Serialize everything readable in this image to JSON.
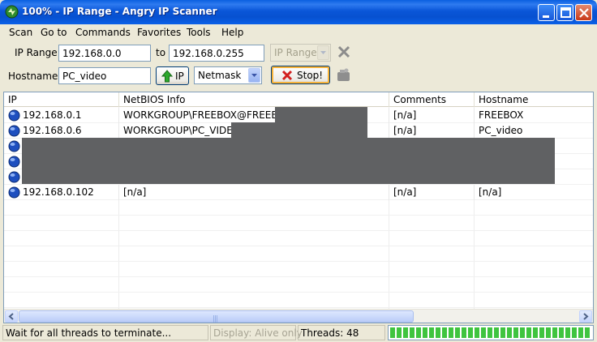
{
  "window": {
    "title": "100% - IP Range - Angry IP Scanner"
  },
  "menu": [
    "Scan",
    "Go to",
    "Commands",
    "Favorites",
    "Tools",
    "Help"
  ],
  "range": {
    "ip_range_label": "IP Range:",
    "start_ip": "192.168.0.0",
    "to_label": "to",
    "end_ip": "192.168.0.255",
    "feeder_select": "IP Range"
  },
  "hostname": {
    "label": "Hostname:",
    "value": "PC_video",
    "ip_button": "IP",
    "netmask_select": "Netmask",
    "stop_button": "Stop!"
  },
  "table": {
    "columns": [
      "IP",
      "NetBIOS Info",
      "Comments",
      "Hostname"
    ],
    "rows": [
      {
        "ip": "192.168.0.1",
        "netbios": "WORKGROUP\\FREEBOX@FREEBOX",
        "comments": "[n/a]",
        "hostname": "FREEBOX"
      },
      {
        "ip": "192.168.0.6",
        "netbios": "WORKGROUP\\PC_VIDEO",
        "comments": "[n/a]",
        "hostname": "PC_video"
      },
      {
        "ip": "",
        "netbios": "",
        "comments": "",
        "hostname": ""
      },
      {
        "ip": "",
        "netbios": "",
        "comments": "",
        "hostname": ""
      },
      {
        "ip": "",
        "netbios": "",
        "comments": "",
        "hostname": ""
      },
      {
        "ip": "192.168.0.102",
        "netbios": "[n/a]",
        "comments": "[n/a]",
        "hostname": "[n/a]"
      }
    ]
  },
  "statusbar": {
    "message": "Wait for all threads to terminate...",
    "display": "Display: Alive only",
    "threads": "Threads: 48",
    "progress": 1.0
  },
  "colors": {
    "titlebar": "#0A56D8",
    "progress_green": "#3FC43F",
    "redaction": "#606163"
  },
  "icons": {
    "app": "angry-ip-scanner-icon",
    "row_status": "blue-globe-icon",
    "clear": "x-clear-icon",
    "fetchers": "fetchers-prefs-icon",
    "ip_button": "green-up-arrow-icon",
    "stop_button": "red-x-icon"
  }
}
